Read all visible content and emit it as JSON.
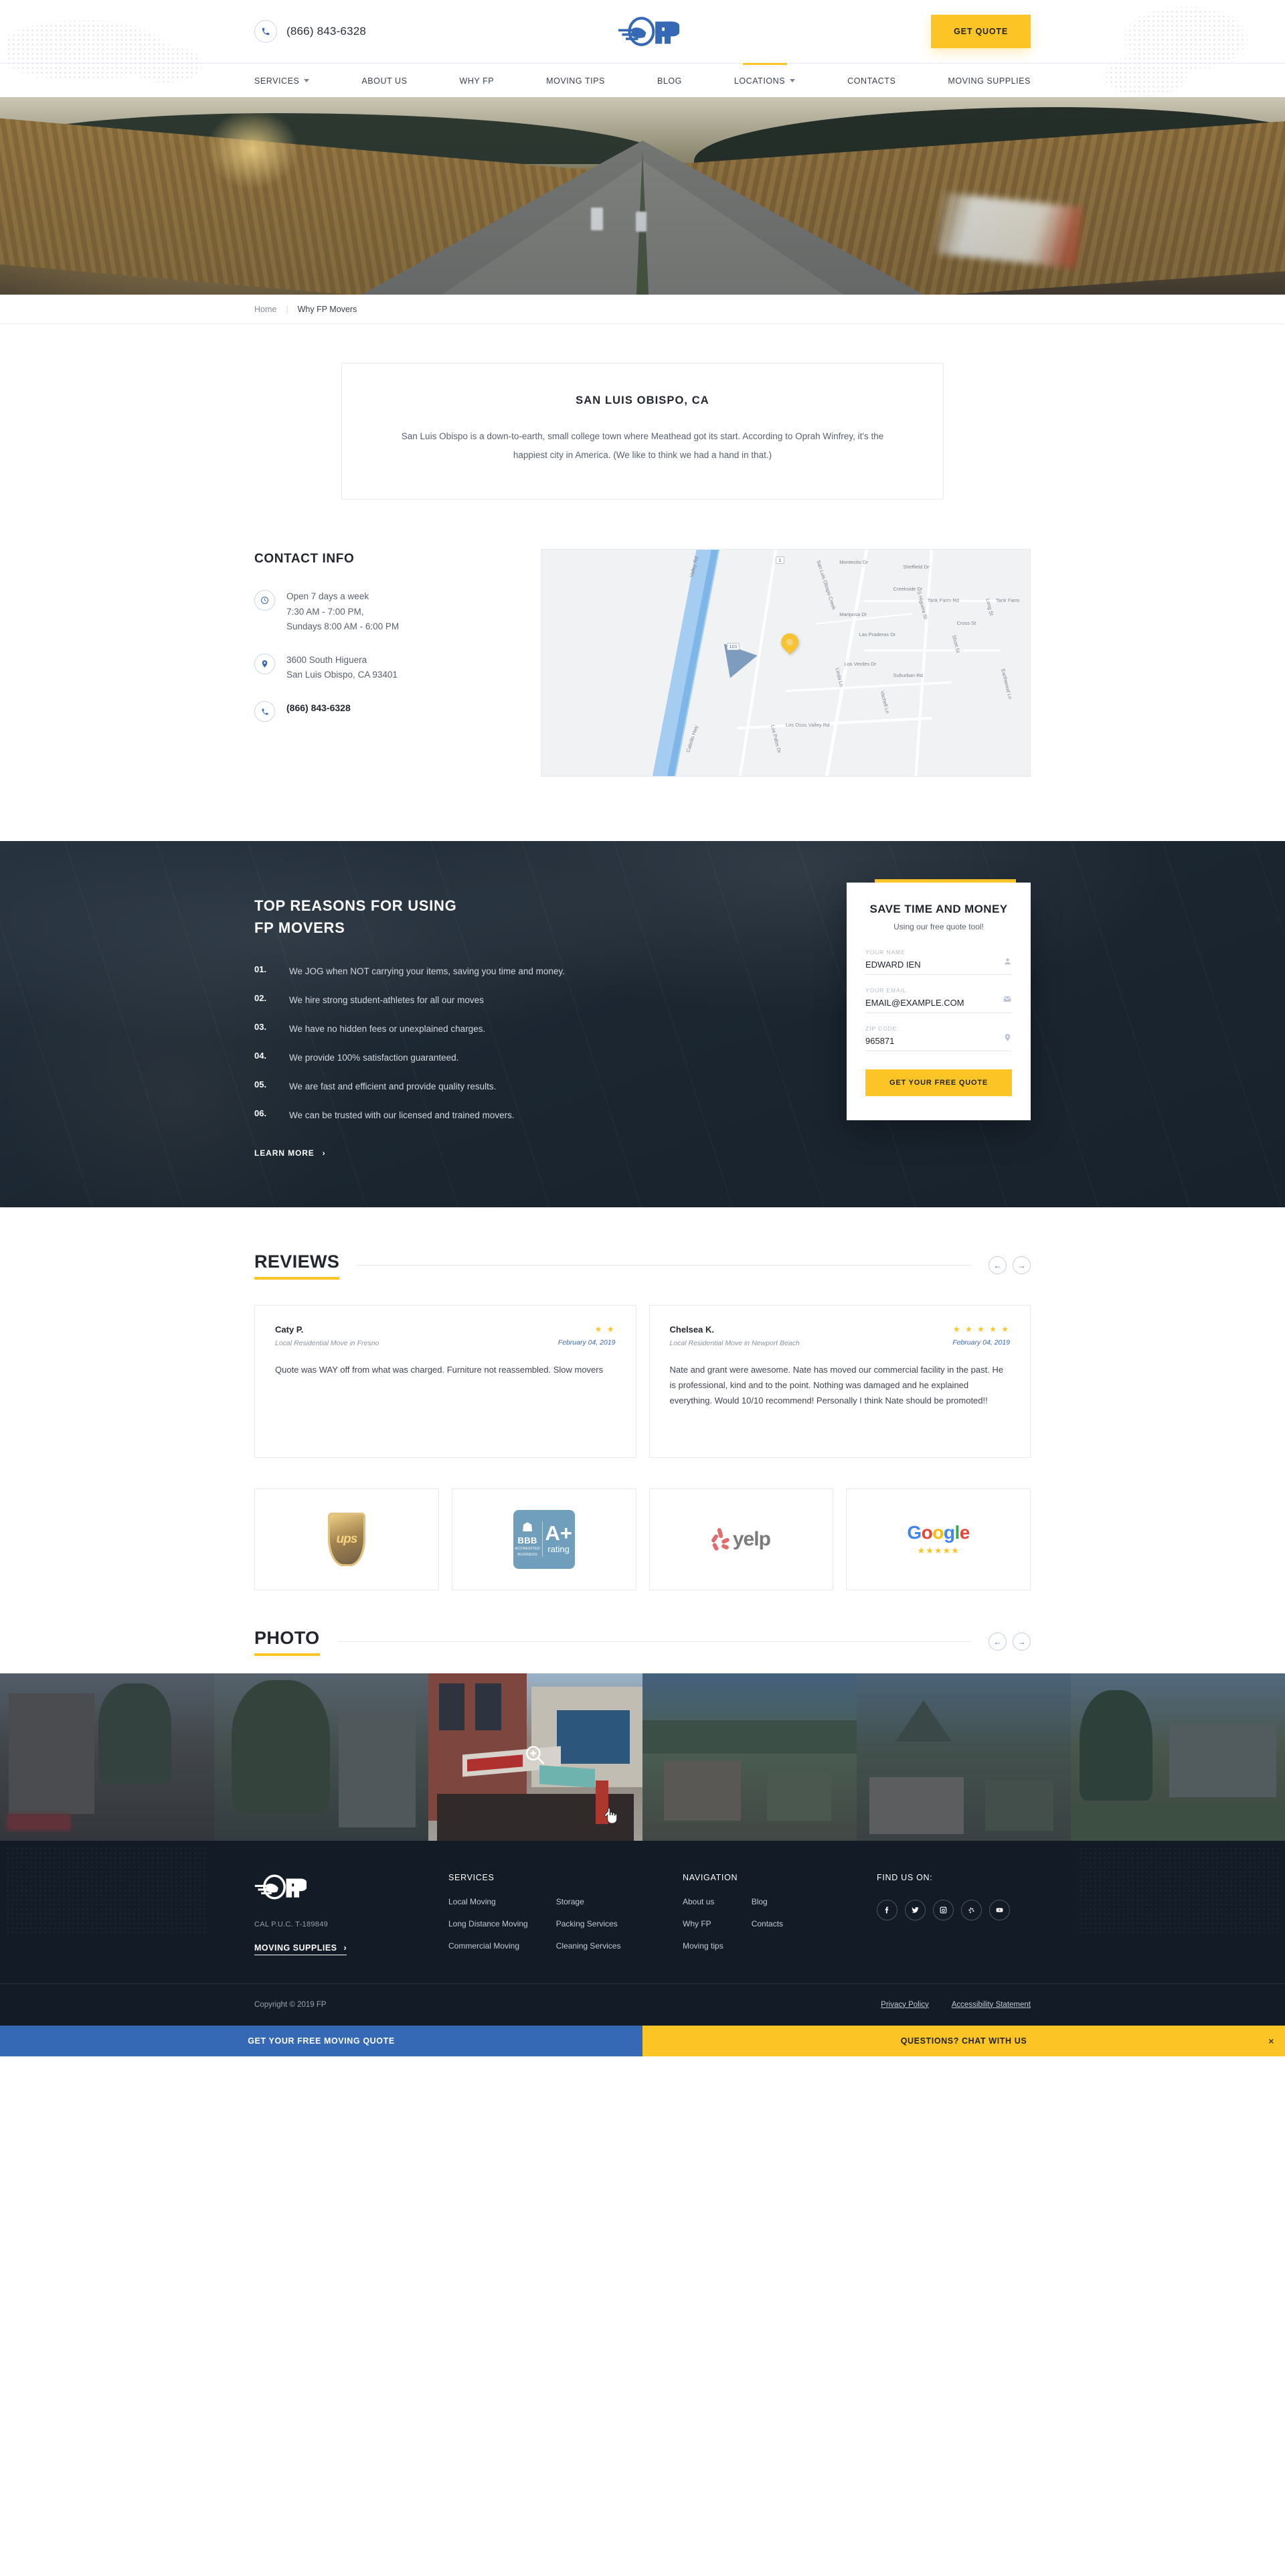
{
  "header": {
    "phone": "(866) 843-6328",
    "phone_icon": "phone-icon",
    "logo_text": "FP",
    "cta_label": "GET QUOTE",
    "nav": [
      {
        "label": "SERVICES",
        "caret": true,
        "active": false
      },
      {
        "label": "ABOUT US",
        "caret": false,
        "active": false
      },
      {
        "label": "WHY FP",
        "caret": false,
        "active": false
      },
      {
        "label": "MOVING TIPS",
        "caret": false,
        "active": false
      },
      {
        "label": "BLOG",
        "caret": false,
        "active": false
      },
      {
        "label": "LOCATIONS",
        "caret": true,
        "active": true
      },
      {
        "label": "CONTACTS",
        "caret": false,
        "active": false
      },
      {
        "label": "MOVING SUPPLIES",
        "caret": false,
        "active": false
      }
    ]
  },
  "breadcrumb": {
    "home": "Home",
    "separator": "|",
    "current": "Why FP Movers"
  },
  "intro": {
    "title": "SAN LUIS OBISPO, CA",
    "body": "San Luis Obispo is a down-to-earth, small college town where Meathead got its start. According to Oprah Winfrey, it's the happiest city in America. (We like to think we had a hand in that.)"
  },
  "contact": {
    "title": "CONTACT INFO",
    "hours_icon": "clock-icon",
    "hours": "Open 7 days a week\n7:30 AM - 7:00 PM,\nSundays 8:00 AM - 6:00 PM",
    "address_icon": "map-pin-icon",
    "address": "3600 South Higuera\nSan Luis Obispo, CA 93401",
    "phone_icon": "phone-icon",
    "phone": "(866) 843-6328",
    "map_labels": [
      "Valley Rd",
      "Los Osos Valley Rd",
      "Calle Joaquin",
      "Cabrillo Hwy",
      "San Luis Obispo Creek",
      "Montecito Dr",
      "Sheffield Dr",
      "Creekside Dr",
      "San Simeon Dr",
      "Mariposa Dr",
      "Las Praderas Dr",
      "S Higuera St",
      "Tank Farm Rd",
      "Tank Farm",
      "Cross St",
      "Short St",
      "Long St",
      "Suburban Rd",
      "Linda Ln",
      "Los Verdes Dr",
      "Vachell Ln",
      "Los Palos Dr",
      "Earthwood Ln",
      "101",
      "1"
    ]
  },
  "reasons": {
    "title": "TOP REASONS FOR USING\nFP MOVERS",
    "items": [
      {
        "num": "01.",
        "text": "We JOG when NOT carrying your items, saving you time and money."
      },
      {
        "num": "02.",
        "text": "We hire strong student-athletes for all our moves"
      },
      {
        "num": "03.",
        "text": "We have no hidden fees or unexplained charges."
      },
      {
        "num": "04.",
        "text": "We provide 100% satisfaction guaranteed."
      },
      {
        "num": "05.",
        "text": "We are fast and efficient and provide quality results."
      },
      {
        "num": "06.",
        "text": "We can be trusted with our licensed and trained movers."
      }
    ],
    "learn_more": "LEARN MORE"
  },
  "quote_form": {
    "title": "SAVE TIME AND MONEY",
    "subtitle": "Using our free quote tool!",
    "fields": [
      {
        "label": "YOUR NAME",
        "value": "EDWARD IEN",
        "placeholder": "YOUR NAME",
        "icon": "user-icon"
      },
      {
        "label": "YOUR EMAIL",
        "value": "EMAIL@EXAMPLE.COM",
        "placeholder": "YOUR EMAIL",
        "icon": "envelope-icon"
      },
      {
        "label": "ZIP CODE",
        "value": "965871",
        "placeholder": "ZIP CODE",
        "icon": "map-pin-icon"
      }
    ],
    "submit_label": "GET YOUR FREE QUOTE",
    "accent_color": "#fcc425"
  },
  "reviews": {
    "title": "REVIEWS",
    "prev_icon": "arrow-left-icon",
    "next_icon": "arrow-right-icon",
    "items": [
      {
        "name": "Caty P.",
        "meta": "Local Residential Move in Fresno",
        "stars": "★ ★",
        "rating": 2,
        "date": "February 04, 2019",
        "body": "Quote was WAY off from what was charged. Furniture not reassembled. Slow movers"
      },
      {
        "name": "Chelsea K.",
        "meta": "Local Residential Move in Newport Beach",
        "stars": "★ ★ ★ ★ ★",
        "rating": 5,
        "date": "February 04, 2019",
        "body": "Nate and grant were awesome. Nate has moved our commercial facility in the past. He is professional, kind and to the point. Nothing was damaged and he explained everything. Would 10/10 recommend! Personally I think Nate should be promoted!!"
      }
    ]
  },
  "badges": [
    {
      "name": "ups-badge",
      "label": "ups"
    },
    {
      "name": "bbb-badge",
      "flame": "BBB",
      "accredited": "ACCREDITED",
      "business": "BUSINESS",
      "grade": "A+",
      "rating": "rating"
    },
    {
      "name": "yelp-badge",
      "label": "yelp"
    },
    {
      "name": "google-badge",
      "label": "Google",
      "stars": "★★★★★"
    }
  ],
  "photo": {
    "title": "PHOTO",
    "prev_icon": "arrow-left-icon",
    "next_icon": "arrow-right-icon",
    "zoom_icon": "magnifier-plus-icon",
    "cursor_icon": "pointer-hand-cursor",
    "count": 6
  },
  "footer": {
    "logo_text": "FP",
    "puc": "CAL P.U.C. T-189849",
    "moving_supplies": "MOVING SUPPLIES",
    "services_heading": "SERVICES",
    "services_col1": [
      "Local Moving",
      "Long Distance Moving",
      "Commercial Moving"
    ],
    "services_col2": [
      "Storage",
      "Packing Services",
      "Cleaning Services"
    ],
    "nav_heading": "NAVIGATION",
    "nav_col1": [
      "About us",
      "Why FP",
      "Moving tips"
    ],
    "nav_col2": [
      "Blog",
      "Contacts"
    ],
    "social_heading": "FIND US ON:",
    "socials": [
      "facebook-icon",
      "twitter-icon",
      "instagram-icon",
      "yelp-icon",
      "youtube-icon"
    ],
    "copyright": "Copyright © 2019 FP",
    "legal": [
      "Privacy Policy",
      "Accessibility Statement"
    ],
    "cta_left": "GET YOUR FREE MOVING QUOTE",
    "cta_right": "QUESTIONS? CHAT WITH US",
    "cta_close": "×"
  },
  "colors": {
    "brand_blue": "#3568b5",
    "accent_yellow": "#fcc425",
    "dark": "#131b26"
  }
}
